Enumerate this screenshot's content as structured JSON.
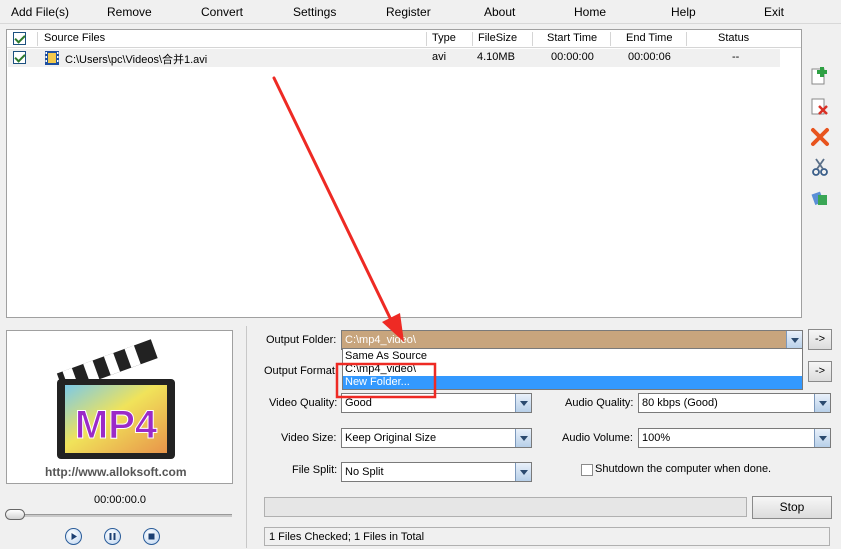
{
  "menu": {
    "add_files": "Add File(s)",
    "remove": "Remove",
    "convert": "Convert",
    "settings": "Settings",
    "register": "Register",
    "about": "About",
    "home": "Home",
    "help": "Help",
    "exit": "Exit"
  },
  "file_list": {
    "columns": [
      "Source Files",
      "Type",
      "FileSize",
      "Start Time",
      "End Time",
      "Status"
    ],
    "rows": [
      {
        "checked": true,
        "path": "C:\\Users\\pc\\Videos\\合并1.avi",
        "type": "avi",
        "size": "4.10MB",
        "start": "00:00:00",
        "end": "00:00:06",
        "status": "--"
      }
    ]
  },
  "side_toolbar": [
    "add-file-icon",
    "remove-file-icon",
    "delete-icon",
    "cut-icon",
    "merge-icon"
  ],
  "preview": {
    "logo_text": "MP4",
    "url": "http://www.alloksoft.com",
    "time": "00:00:00.0",
    "seek_position": 0
  },
  "form": {
    "output_folder_label": "Output Folder:",
    "output_folder_value": "C:\\mp4_video\\",
    "output_format_label": "Output Format:",
    "video_quality_label": "Video Quality:",
    "video_quality_value": "Good",
    "audio_quality_label": "Audio Quality:",
    "audio_quality_value": "80  kbps (Good)",
    "video_size_label": "Video Size:",
    "video_size_value": "Keep Original Size",
    "audio_volume_label": "Audio Volume:",
    "audio_volume_value": "100%",
    "file_split_label": "File Split:",
    "file_split_value": "No Split",
    "shutdown_label": "Shutdown the computer when done.",
    "browse_label": "->"
  },
  "dropdown": {
    "options": [
      "Same As Source",
      "C:\\mp4_video\\",
      "New Folder..."
    ],
    "highlighted_index": 2
  },
  "stop_label": "Stop",
  "status_text": "1 Files Checked; 1 Files in Total",
  "colors": {
    "highlight": "#3399ff",
    "folder_field": "#c8a57d",
    "annotation": "#ee2a24"
  }
}
